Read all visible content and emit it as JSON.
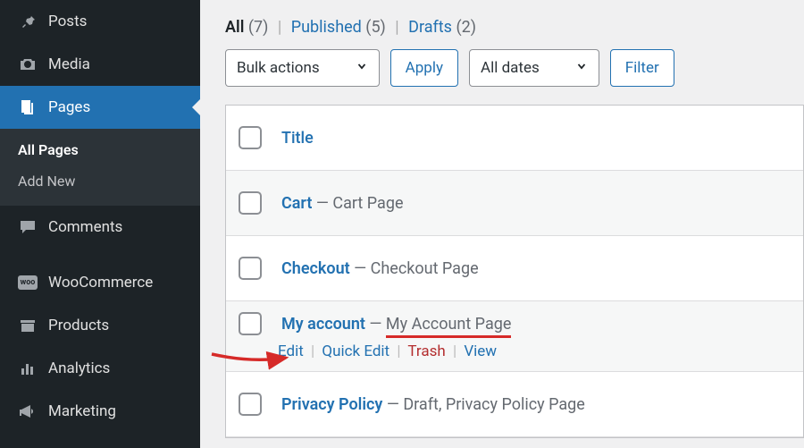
{
  "sidebar": {
    "items": [
      {
        "icon": "pin",
        "label": "Posts"
      },
      {
        "icon": "camera",
        "label": "Media"
      },
      {
        "icon": "pages",
        "label": "Pages"
      },
      {
        "icon": "comment",
        "label": "Comments"
      },
      {
        "icon": "woo",
        "label": "WooCommerce"
      },
      {
        "icon": "archive",
        "label": "Products"
      },
      {
        "icon": "analytics",
        "label": "Analytics"
      },
      {
        "icon": "megaphone",
        "label": "Marketing"
      }
    ],
    "submenu": {
      "all_pages": "All Pages",
      "add_new": "Add New"
    }
  },
  "filters": {
    "all_label": "All",
    "all_count": "(7)",
    "published_label": "Published",
    "published_count": "(5)",
    "drafts_label": "Drafts",
    "drafts_count": "(2)"
  },
  "controls": {
    "bulk_actions": "Bulk actions",
    "apply": "Apply",
    "all_dates": "All dates",
    "filter": "Filter"
  },
  "table": {
    "title_header": "Title",
    "rows": [
      {
        "title": "Cart",
        "meta": " — Cart Page"
      },
      {
        "title": "Checkout",
        "meta": " — Checkout Page"
      },
      {
        "title": "My account",
        "meta_prefix": " — ",
        "meta_underlined": "My Account Page"
      },
      {
        "title": "Privacy Policy",
        "meta": " — Draft, Privacy Policy Page"
      }
    ],
    "row_actions": {
      "edit": "Edit",
      "quick_edit": "Quick Edit",
      "trash": "Trash",
      "view": "View"
    }
  }
}
